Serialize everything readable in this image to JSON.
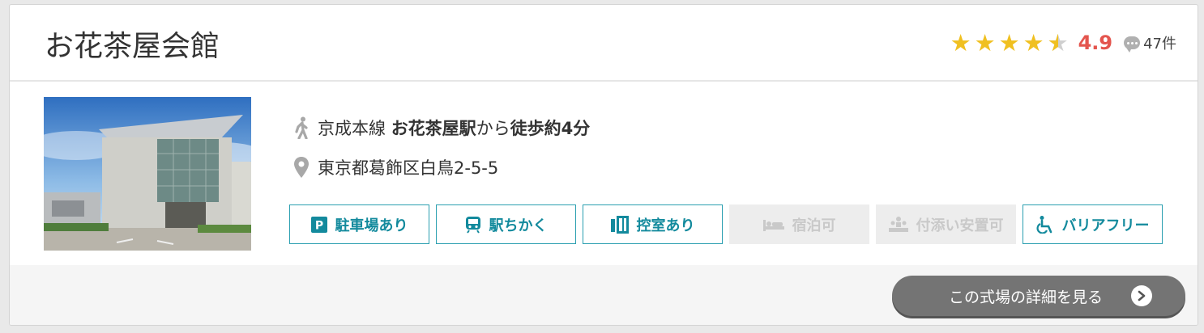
{
  "venue": {
    "name": "お花茶屋会館",
    "rating": {
      "stars": 4.5,
      "score": "4.9",
      "review_count": "47件"
    },
    "access": {
      "line": "京成本線 ",
      "station": "お花茶屋駅",
      "from": "から",
      "walk": "徒歩約4分"
    },
    "address": "東京都葛飾区白鳥2-5-5",
    "features": [
      {
        "label": "駐車場あり",
        "icon": "parking-icon",
        "active": true
      },
      {
        "label": "駅ちかく",
        "icon": "train-icon",
        "active": true
      },
      {
        "label": "控室あり",
        "icon": "waiting-room-icon",
        "active": true
      },
      {
        "label": "宿泊可",
        "icon": "bed-icon",
        "active": false
      },
      {
        "label": "付添い安置可",
        "icon": "attendance-icon",
        "active": false
      },
      {
        "label": "バリアフリー",
        "icon": "wheelchair-icon",
        "active": true
      }
    ],
    "detail_button": "この式場の詳細を見る"
  },
  "colors": {
    "accent": "#138a9d",
    "score": "#e4554e",
    "star": "#f0c020",
    "button": "#747474"
  }
}
